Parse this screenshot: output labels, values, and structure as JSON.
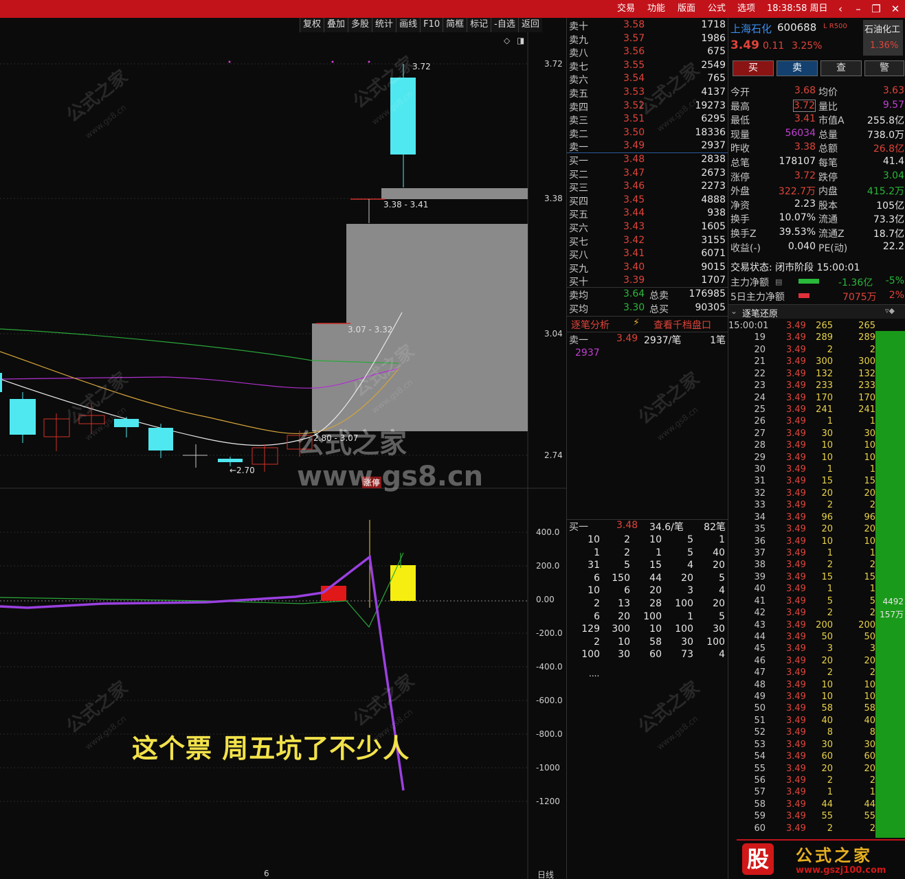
{
  "titlebar": {
    "menus": [
      "交易",
      "功能",
      "版面",
      "公式",
      "选项"
    ],
    "clock": "18:38:58 周日",
    "controls": [
      "‹",
      "–",
      "❐",
      "✕"
    ]
  },
  "toolbar": [
    "复权",
    "叠加",
    "多股",
    "统计",
    "画线",
    "F10",
    "简框",
    "标记",
    "-自选",
    "返回"
  ],
  "chart": {
    "price_axis": [
      "3.72",
      "3.38",
      "3.04",
      "2.74"
    ],
    "indicator_axis": [
      "400.0",
      "200.0",
      "0.00",
      "-200.0",
      "-400.0",
      "-600.0",
      "-800.0",
      "-1000",
      "-1200"
    ],
    "gap_label_1": "3.38 - 3.41",
    "gap_label_2": "3.07 - 3.32",
    "gap_label_3": "2.80 - 3.07",
    "high_label": "3.72",
    "low_label": "←2.70",
    "zhangting_tag": "涨停",
    "x_label": "6",
    "period": "日线",
    "caption": "这个票 周五坑了不少人",
    "watermark": "公式之家 www.gs8.cn",
    "watermark_small": "公式之家",
    "watermark_url": "www.gs8.cn"
  },
  "orderbook": {
    "asks": [
      {
        "label": "卖十",
        "price": "3.58",
        "vol": "1718"
      },
      {
        "label": "卖九",
        "price": "3.57",
        "vol": "1986"
      },
      {
        "label": "卖八",
        "price": "3.56",
        "vol": "675"
      },
      {
        "label": "卖七",
        "price": "3.55",
        "vol": "2549"
      },
      {
        "label": "卖六",
        "price": "3.54",
        "vol": "765"
      },
      {
        "label": "卖五",
        "price": "3.53",
        "vol": "4137"
      },
      {
        "label": "卖四",
        "price": "3.52",
        "vol": "19273"
      },
      {
        "label": "卖三",
        "price": "3.51",
        "vol": "6295"
      },
      {
        "label": "卖二",
        "price": "3.50",
        "vol": "18336"
      },
      {
        "label": "卖一",
        "price": "3.49",
        "vol": "2937"
      }
    ],
    "bids": [
      {
        "label": "买一",
        "price": "3.48",
        "vol": "2838"
      },
      {
        "label": "买二",
        "price": "3.47",
        "vol": "2673"
      },
      {
        "label": "买三",
        "price": "3.46",
        "vol": "2273"
      },
      {
        "label": "买四",
        "price": "3.45",
        "vol": "4888"
      },
      {
        "label": "买五",
        "price": "3.44",
        "vol": "938"
      },
      {
        "label": "买六",
        "price": "3.43",
        "vol": "1605"
      },
      {
        "label": "买七",
        "price": "3.42",
        "vol": "3155"
      },
      {
        "label": "买八",
        "price": "3.41",
        "vol": "6071"
      },
      {
        "label": "买九",
        "price": "3.40",
        "vol": "9015"
      },
      {
        "label": "买十",
        "price": "3.39",
        "vol": "1707"
      }
    ],
    "avg_sell": {
      "label": "卖均",
      "price": "3.64",
      "k": "总卖",
      "v": "176985"
    },
    "avg_buy": {
      "label": "买均",
      "price": "3.30",
      "k": "总买",
      "v": "90305"
    },
    "tab1": "逐笔分析",
    "tab2": "查看千档盘口",
    "ask1_detail": {
      "label": "卖一",
      "price": "3.49",
      "per": "2937/笔",
      "count": "1笔",
      "first": "2937"
    },
    "bid1_detail": {
      "label": "买一",
      "price": "3.48",
      "per": "34.6/笔",
      "count": "82笔"
    },
    "bid1_grid": [
      [
        "10",
        "2",
        "10",
        "5",
        "1"
      ],
      [
        "1",
        "2",
        "1",
        "5",
        "40"
      ],
      [
        "31",
        "5",
        "15",
        "4",
        "20"
      ],
      [
        "6",
        "150",
        "44",
        "20",
        "5"
      ],
      [
        "10",
        "6",
        "20",
        "3",
        "4"
      ],
      [
        "2",
        "13",
        "28",
        "100",
        "20"
      ],
      [
        "6",
        "20",
        "100",
        "1",
        "5"
      ],
      [
        "129",
        "300",
        "10",
        "100",
        "30"
      ],
      [
        "2",
        "10",
        "58",
        "30",
        "100"
      ],
      [
        "100",
        "30",
        "60",
        "73",
        "4"
      ]
    ],
    "more": "...."
  },
  "info": {
    "name": "上海石化",
    "code": "600688",
    "badge": "L R500",
    "industry": "石油化工",
    "industry_pct": "1.36%",
    "price": "3.49",
    "change": "0.11",
    "pct": "3.25%",
    "buttons": [
      "买",
      "卖",
      "查",
      "警"
    ],
    "rows": [
      [
        "今开",
        "3.68",
        "均价",
        "3.63"
      ],
      [
        "最高",
        "3.72",
        "量比",
        "9.57"
      ],
      [
        "最低",
        "3.41",
        "市值A",
        "255.8亿"
      ],
      [
        "现量",
        "56034",
        "总量",
        "738.0万"
      ],
      [
        "昨收",
        "3.38",
        "总额",
        "26.8亿"
      ],
      [
        "总笔",
        "178107",
        "每笔",
        "41.4"
      ],
      [
        "涨停",
        "3.72",
        "跌停",
        "3.04"
      ],
      [
        "外盘",
        "322.7万",
        "内盘",
        "415.2万"
      ],
      [
        "净资",
        "2.23",
        "股本",
        "105亿"
      ],
      [
        "换手",
        "10.07%",
        "流通",
        "73.3亿"
      ],
      [
        "换手Z",
        "39.53%",
        "流通Z",
        "18.7亿"
      ],
      [
        "收益(-)",
        "0.040",
        "PE(动)",
        "22.2"
      ]
    ],
    "status": "交易状态: 闭市阶段 15:00:01",
    "main_net": {
      "label": "主力净额",
      "value": "-1.36亿",
      "pct": "-5%"
    },
    "five_day_net": {
      "label": "5日主力净额",
      "value": "7075万",
      "pct": "2%"
    },
    "tick_title": "逐笔还原"
  },
  "ticks": {
    "rows": [
      [
        "15:00:01",
        "3.49",
        "265",
        "265"
      ],
      [
        "19",
        "3.49",
        "289",
        "289"
      ],
      [
        "20",
        "3.49",
        "2",
        "2"
      ],
      [
        "21",
        "3.49",
        "300",
        "300"
      ],
      [
        "22",
        "3.49",
        "132",
        "132"
      ],
      [
        "23",
        "3.49",
        "233",
        "233"
      ],
      [
        "24",
        "3.49",
        "170",
        "170"
      ],
      [
        "25",
        "3.49",
        "241",
        "241"
      ],
      [
        "26",
        "3.49",
        "1",
        "1"
      ],
      [
        "27",
        "3.49",
        "30",
        "30"
      ],
      [
        "28",
        "3.49",
        "10",
        "10"
      ],
      [
        "29",
        "3.49",
        "10",
        "10"
      ],
      [
        "30",
        "3.49",
        "1",
        "1"
      ],
      [
        "31",
        "3.49",
        "15",
        "15"
      ],
      [
        "32",
        "3.49",
        "20",
        "20"
      ],
      [
        "33",
        "3.49",
        "2",
        "2"
      ],
      [
        "34",
        "3.49",
        "96",
        "96"
      ],
      [
        "35",
        "3.49",
        "20",
        "20"
      ],
      [
        "36",
        "3.49",
        "10",
        "10"
      ],
      [
        "37",
        "3.49",
        "1",
        "1"
      ],
      [
        "38",
        "3.49",
        "2",
        "2"
      ],
      [
        "39",
        "3.49",
        "15",
        "15"
      ],
      [
        "40",
        "3.49",
        "1",
        "1"
      ],
      [
        "41",
        "3.49",
        "5",
        "5"
      ],
      [
        "42",
        "3.49",
        "2",
        "2"
      ],
      [
        "43",
        "3.49",
        "200",
        "200"
      ],
      [
        "44",
        "3.49",
        "50",
        "50"
      ],
      [
        "45",
        "3.49",
        "3",
        "3"
      ],
      [
        "46",
        "3.49",
        "20",
        "20"
      ],
      [
        "47",
        "3.49",
        "2",
        "2"
      ],
      [
        "48",
        "3.49",
        "10",
        "10"
      ],
      [
        "49",
        "3.49",
        "10",
        "10"
      ],
      [
        "50",
        "3.49",
        "58",
        "58"
      ],
      [
        "51",
        "3.49",
        "40",
        "40"
      ],
      [
        "52",
        "3.49",
        "8",
        "8"
      ],
      [
        "53",
        "3.49",
        "30",
        "30"
      ],
      [
        "54",
        "3.49",
        "60",
        "60"
      ],
      [
        "55",
        "3.49",
        "20",
        "20"
      ],
      [
        "56",
        "3.49",
        "2",
        "2"
      ],
      [
        "57",
        "3.49",
        "1",
        "1"
      ],
      [
        "58",
        "3.49",
        "44",
        "44"
      ],
      [
        "59",
        "3.49",
        "55",
        "55"
      ],
      [
        "60",
        "3.49",
        "2",
        "2"
      ]
    ],
    "bar_label_1": "4492",
    "bar_label_2": "157万"
  },
  "logo": {
    "char": "股",
    "text": "公式之家",
    "url": "www.gszj100.com"
  }
}
